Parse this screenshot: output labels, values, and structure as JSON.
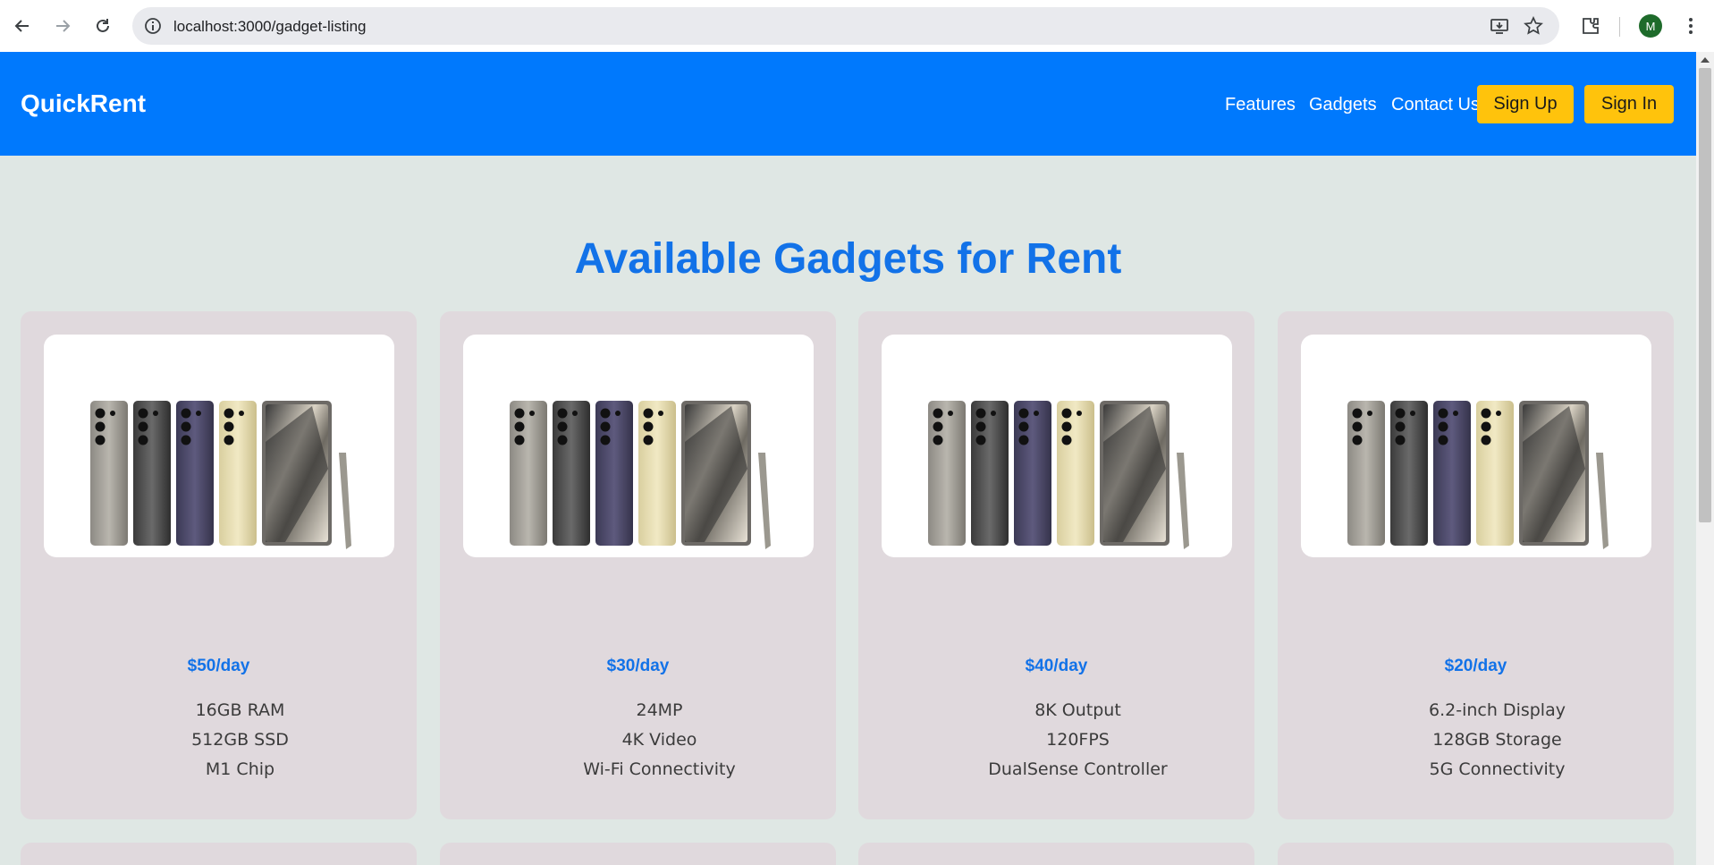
{
  "browser": {
    "url": "localhost:3000/gadget-listing",
    "avatar_letter": "M",
    "icons": [
      "back-icon",
      "forward-icon",
      "reload-icon",
      "site-info-icon",
      "install-app-icon",
      "bookmark-star-icon",
      "extensions-icon",
      "menu-dots-icon"
    ]
  },
  "header": {
    "logo": "QuickRent",
    "nav": [
      "Features",
      "Gadgets",
      "Contact Us"
    ],
    "sign_up": "Sign Up",
    "sign_in": "Sign In",
    "colors": {
      "bar": "#0079fd",
      "button": "#ffc30c"
    }
  },
  "main": {
    "title": "Available Gadgets for Rent",
    "cards": [
      {
        "price": "$50/day",
        "features": [
          "16GB RAM",
          "512GB SSD",
          "M1 Chip"
        ]
      },
      {
        "price": "$30/day",
        "features": [
          "24MP",
          "4K Video",
          "Wi-Fi Connectivity"
        ]
      },
      {
        "price": "$40/day",
        "features": [
          "8K Output",
          "120FPS",
          "DualSense Controller"
        ]
      },
      {
        "price": "$20/day",
        "features": [
          "6.2-inch Display",
          "128GB Storage",
          "5G Connectivity"
        ]
      }
    ]
  }
}
